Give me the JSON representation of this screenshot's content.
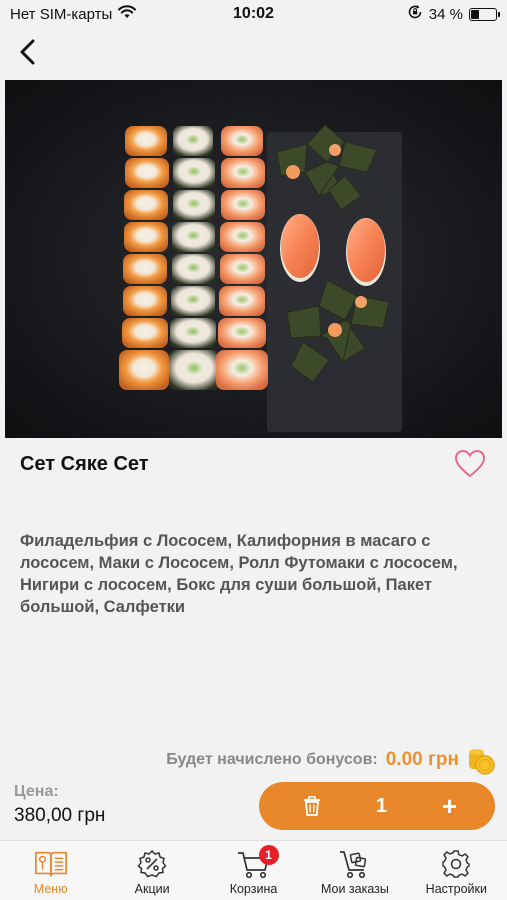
{
  "status_bar": {
    "carrier": "Нет SIM-карты",
    "time": "10:02",
    "battery_percent": "34 %",
    "battery_level": 0.34
  },
  "product": {
    "title": "Сет Сяке Сет",
    "description": "Филадельфия с Лососем, Калифорния в масаго с лососем, Маки с Лососем, Ролл Футомаки с лососем, Нигири с лососем, Бокс для суши большой, Пакет большой, Салфетки",
    "bonus_label": "Будет начислено бонусов:",
    "bonus_value": "0.00 грн",
    "price_label": "Цена:",
    "price_value": "380,00 грн",
    "quantity": "1",
    "plus_label": "+"
  },
  "tabs": [
    {
      "label": "Меню",
      "icon": "menu-book-icon",
      "active": true
    },
    {
      "label": "Акции",
      "icon": "discount-icon",
      "active": false
    },
    {
      "label": "Корзина",
      "icon": "cart-icon",
      "active": false,
      "badge": "1"
    },
    {
      "label": "Мои заказы",
      "icon": "orders-icon",
      "active": false
    },
    {
      "label": "Настройки",
      "icon": "gear-icon",
      "active": false
    }
  ],
  "colors": {
    "accent": "#e8872a",
    "badge": "#e5202a",
    "heart": "#e86a8a"
  }
}
